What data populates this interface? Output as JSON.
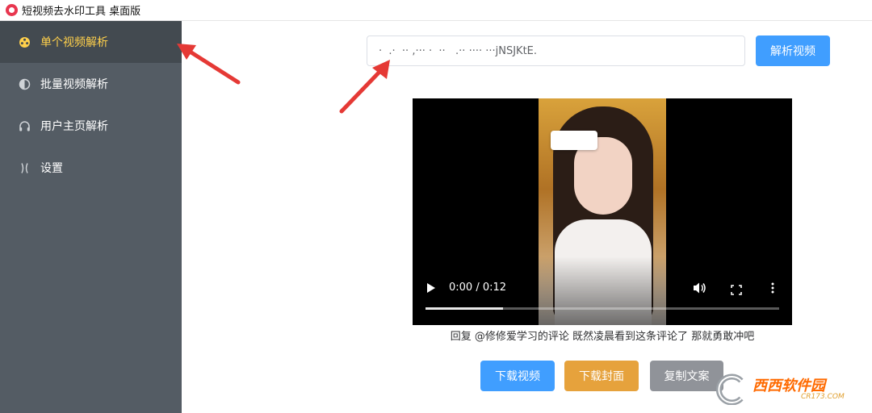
{
  "window": {
    "title": "短视频去水印工具 桌面版"
  },
  "sidebar": {
    "items": [
      {
        "label": "单个视频解析",
        "icon": "film-reel-icon",
        "active": true
      },
      {
        "label": "批量视频解析",
        "icon": "half-circle-icon",
        "active": false
      },
      {
        "label": "用户主页解析",
        "icon": "headphones-icon",
        "active": false
      },
      {
        "label": "设置",
        "icon": "brackets-icon",
        "active": false
      }
    ],
    "bg_color": "#545c64",
    "active_color": "#ffd04b"
  },
  "search": {
    "value": "·  .·  ·· ,··· ·  ··   .·· ···· ···jNSJKtE."
  },
  "parse_button": {
    "label": "解析视频",
    "color": "#409eff"
  },
  "video": {
    "time": "0:00 / 0:12",
    "progress": 0.22,
    "caption": "回复 @修修爱学习的评论 既然凌晨看到这条评论了 那就勇敢冲吧"
  },
  "actions": {
    "download_video": "下载视频",
    "download_cover": "下载封面",
    "copy_text": "复制文案"
  },
  "watermark": {
    "brand": "西西软件园",
    "domain": "CR173.COM"
  }
}
